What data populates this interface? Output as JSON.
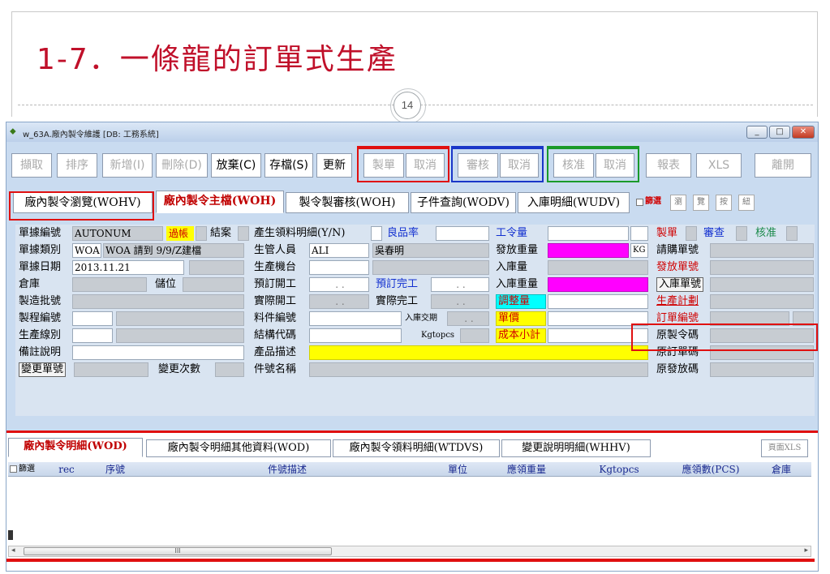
{
  "slide": {
    "title": "1-7．一條龍的訂單式生產",
    "page_number": "14"
  },
  "window": {
    "title": "w_63A.廠內製令維護 [DB: 工務系統]",
    "buttons": [
      "_",
      "□",
      "✕"
    ]
  },
  "toolbar": {
    "buttons": [
      "擷取",
      "排序",
      "新增(I)",
      "刪除(D)",
      "放棄(C)",
      "存檔(S)",
      "更新",
      "製單",
      "取消",
      "審核",
      "取消",
      "核准",
      "取消",
      "報表",
      "XLS",
      "離開"
    ]
  },
  "tabs": {
    "items": [
      "廠內製令瀏覽(WOHV)",
      "廠內製令主檔(WOH)",
      "製令製審核(WOH)",
      "子件查詢(WODV)",
      "入庫明細(WUDV)"
    ],
    "filter_label": "篩選",
    "small": [
      "瀏",
      "覽",
      "按",
      "紐"
    ]
  },
  "form": {
    "doc_no_label": "單據編號",
    "doc_no_value": "AUTONUM",
    "posted_label": "過帳",
    "closed_label": "結案",
    "mat_detail_label": "產生領料明細(Y/N)",
    "yield_label": "良品率",
    "work_qty_label": "工令量",
    "made_label": "製單",
    "reviewed_label": "審查",
    "approved_label": "核准",
    "doc_type_label": "單據類別",
    "doc_type_value": "WOA",
    "doc_type_desc": "WOA 請到 9/9/Z建檔",
    "mgr_label": "生管人員",
    "mgr_value": "ALI",
    "mgr_name": "吳春明",
    "issue_wt_label": "發放重量",
    "kg_unit": "KG",
    "purchase_no_label": "請購單號",
    "doc_date_label": "單據日期",
    "doc_date_value": "2013.11.21",
    "machine_label": "生產機台",
    "in_qty_label": "入庫量",
    "issue_no_label": "發放單號",
    "warehouse_label": "倉庫",
    "location_label": "儲位",
    "plan_start_label": "預訂開工",
    "date_ph": ".  .",
    "plan_end_label": "預訂完工",
    "in_wt_label": "入庫重量",
    "in_no_label": "入庫單號",
    "batch_label": "製造批號",
    "act_start_label": "實際開工",
    "act_end_label": "實際完工",
    "adjust_label": "調整量",
    "plan_label": "生產計劃",
    "process_label": "製程編號",
    "part_no_label": "料件編號",
    "in_date_label": "入庫交期",
    "price_label": "單價",
    "order_no_label": "訂單編號",
    "line_label": "生產線別",
    "struct_label": "結構代碼",
    "kgtopcs_label": "Kgtopcs",
    "cost_label": "成本小計",
    "orig_wo_label": "原製令碼",
    "remark_label": "備註說明",
    "desc_label": "產品描述",
    "orig_order_label": "原訂單碼",
    "change_no_label": "變更單號",
    "change_cnt_label": "變更次數",
    "part_name_label": "件號名稱",
    "orig_issue_label": "原發放碼"
  },
  "lower": {
    "tabs": [
      "廠內製令明細(WOD)",
      "廠內製令明細其他資料(WOD)",
      "廠內製令領料明細(WTDVS)",
      "變更說明明細(WHHV)"
    ],
    "page_xls": "頁面XLS",
    "filter_label": "篩選",
    "columns": [
      "rec",
      "序號",
      "件號描述",
      "單位",
      "應領重量",
      "Kgtopcs",
      "應領數(PCS)",
      "倉庫"
    ],
    "scroll_thumb": "III"
  },
  "colors": {
    "title": "#c0102a",
    "magenta": "#ff00ff",
    "yellow": "#ffff00",
    "cyan": "#00ffff",
    "highlight": "#e01010"
  }
}
